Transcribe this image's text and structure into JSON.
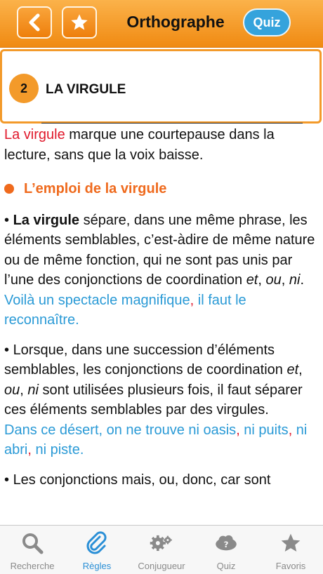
{
  "header": {
    "title": "Orthographe",
    "quiz_label": "Quiz",
    "back_icon": "chevron-left-icon",
    "favorite_icon": "star-icon"
  },
  "section": {
    "number": "2",
    "title": "LA VIRGULE"
  },
  "content": {
    "intro_highlight": "La virgule",
    "intro_rest": " marque une courtepause dans la lecture, sans que la voix baisse.",
    "heading": "L’emploi de la virgule",
    "rule1_bold": "La virgule",
    "rule1_a": " sépare, dans une même phrase, les éléments semblables, c’est-àdire de même nature ou de même fonction, qui ne sont pas unis par l’une des conjonctions de coordination ",
    "rule1_et": "et",
    "rule1_sep1": ", ",
    "rule1_ou": "ou",
    "rule1_sep2": ", ",
    "rule1_ni": "ni",
    "rule1_end": ".",
    "example1_a": "Voilà un spectacle magnifique",
    "example1_comma": ",",
    "example1_b": " il faut le reconnaître.",
    "rule2_a": "Lorsque, dans une succession d’éléments semblables, les conjonctions de coordination ",
    "rule2_et": "et",
    "rule2_sep1": ", ",
    "rule2_ou": "ou",
    "rule2_sep2": ", ",
    "rule2_ni": "ni",
    "rule2_b": " sont utilisées plusieurs fois, il faut séparer ces éléments semblables par des virgules.",
    "example2_a": "Dans ce désert, on ne trouve ni oasis",
    "example2_c1": ",",
    "example2_b": " ni puits",
    "example2_c2": ",",
    "example2_c": " ni abri",
    "example2_c3": ",",
    "example2_d": " ni piste.",
    "rule3_partial": "Les conjonctions mais, ou, donc, car sont"
  },
  "tabs": [
    {
      "label": "Recherche",
      "icon": "search-icon",
      "active": false
    },
    {
      "label": "Règles",
      "icon": "paperclip-icon",
      "active": true
    },
    {
      "label": "Conjugueur",
      "icon": "gears-icon",
      "active": false
    },
    {
      "label": "Quiz",
      "icon": "question-cloud-icon",
      "active": false
    },
    {
      "label": "Favoris",
      "icon": "star-icon",
      "active": false
    }
  ],
  "colors": {
    "header_orange": "#f39a2a",
    "highlight_red": "#e0182b",
    "example_blue": "#2a9ad6",
    "heading_orange": "#ef6a1d",
    "active_tab_blue": "#2a8fd6"
  }
}
